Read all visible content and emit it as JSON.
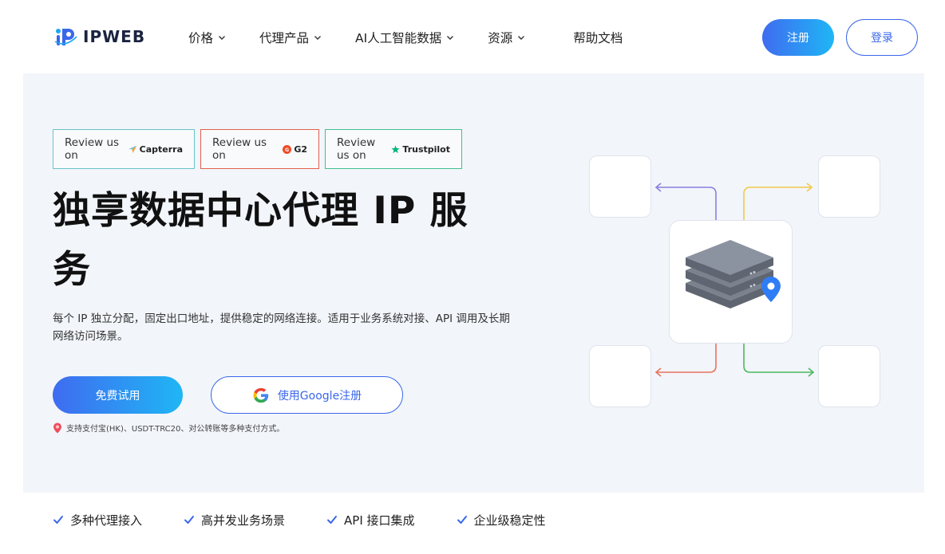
{
  "header": {
    "logo_text": "IPWEB",
    "nav": [
      {
        "label": "价格",
        "has_dropdown": true
      },
      {
        "label": "代理产品",
        "has_dropdown": true
      },
      {
        "label": "AI人工智能数据",
        "has_dropdown": true
      },
      {
        "label": "资源",
        "has_dropdown": true
      },
      {
        "label": "帮助文档",
        "has_dropdown": false
      }
    ],
    "register_label": "注册",
    "login_label": "登录"
  },
  "hero": {
    "reviews": [
      {
        "prefix": "Review us on",
        "brand": "Capterra"
      },
      {
        "prefix": "Review us on",
        "brand": "G2"
      },
      {
        "prefix": "Review us on",
        "brand": "Trustpilot"
      }
    ],
    "title": "独享数据中心代理 IP 服务",
    "description": "每个 IP 独立分配，固定出口地址，提供稳定的网络连接。适用于业务系统对接、API 调用及长期网络访问场景。",
    "trial_button": "免费试用",
    "google_button": "使用Google注册",
    "payment_note": "支持支付宝(HK)、USDT-TRC20、对公转账等多种支付方式。"
  },
  "features": [
    {
      "label": "多种代理接入"
    },
    {
      "label": "高并发业务场景"
    },
    {
      "label": "API 接口集成"
    },
    {
      "label": "企业级稳定性"
    }
  ],
  "colors": {
    "primary": "#3a67ea",
    "gradient_start": "#3f6cf0",
    "gradient_end": "#1fb6f5",
    "hero_bg": "#f2f5fa",
    "line_purple": "#8a7fe0",
    "line_yellow": "#f2c84b",
    "line_red": "#e8735e",
    "line_green": "#4cb860"
  }
}
